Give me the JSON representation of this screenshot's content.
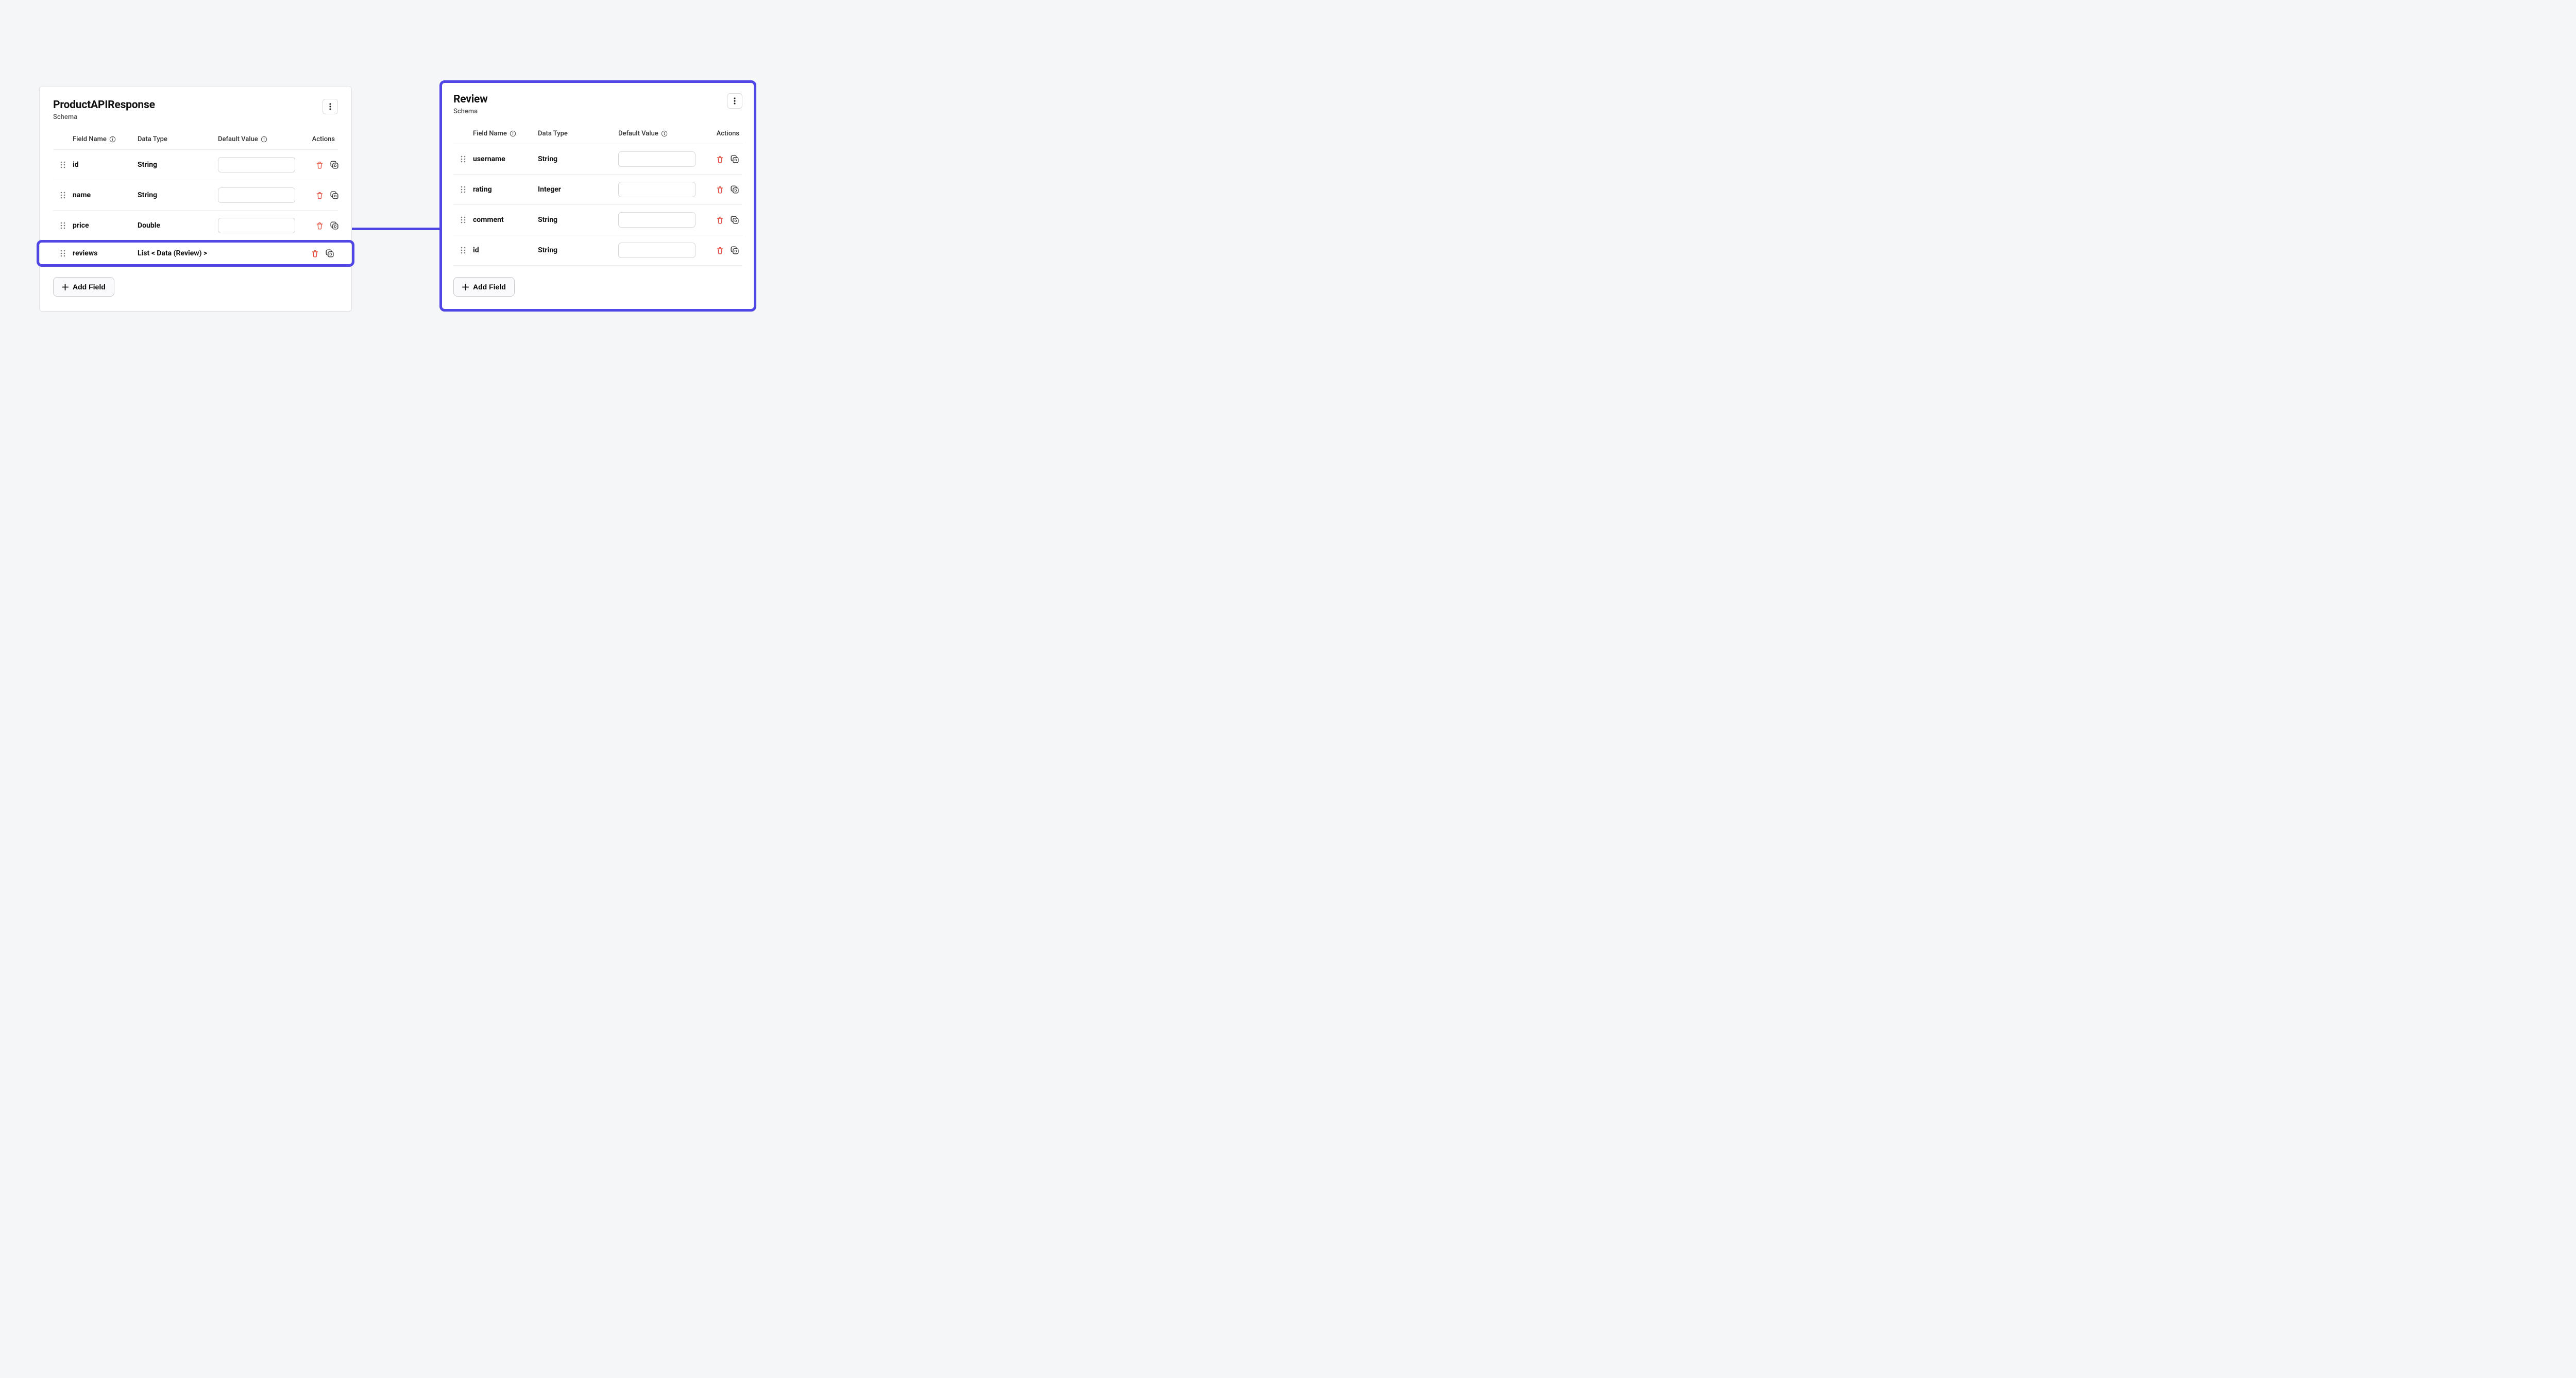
{
  "left": {
    "title": "ProductAPIResponse",
    "subtitle": "Schema",
    "columns": {
      "field": "Field Name",
      "type": "Data Type",
      "default": "Default Value",
      "actions": "Actions"
    },
    "rows": [
      {
        "name": "id",
        "type": "String",
        "default": ""
      },
      {
        "name": "name",
        "type": "String",
        "default": ""
      },
      {
        "name": "price",
        "type": "Double",
        "default": ""
      },
      {
        "name": "reviews",
        "type": "List < Data (Review) >",
        "default": "",
        "highlight": true,
        "no_default_input": true
      }
    ],
    "add_label": "Add Field"
  },
  "right": {
    "title": "Review",
    "subtitle": "Schema",
    "columns": {
      "field": "Field Name",
      "type": "Data Type",
      "default": "Default Value",
      "actions": "Actions"
    },
    "rows": [
      {
        "name": "username",
        "type": "String",
        "default": ""
      },
      {
        "name": "rating",
        "type": "Integer",
        "default": ""
      },
      {
        "name": "comment",
        "type": "String",
        "default": ""
      },
      {
        "name": "id",
        "type": "String",
        "default": ""
      }
    ],
    "add_label": "Add Field"
  },
  "colors": {
    "accent": "#4f46e5",
    "danger": "#e24b3b"
  }
}
